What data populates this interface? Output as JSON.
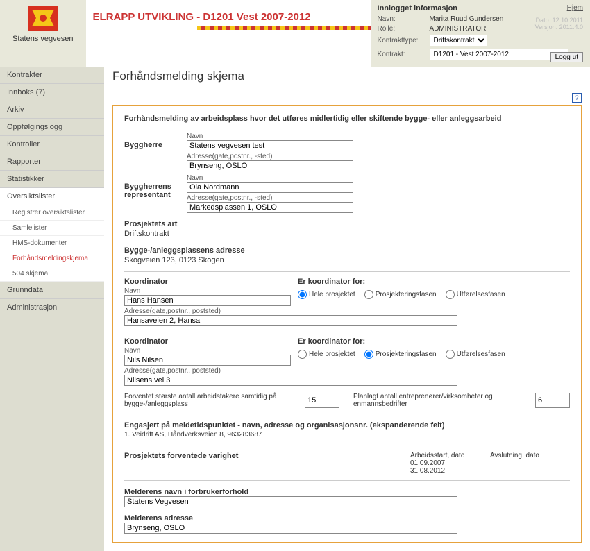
{
  "brand": "Statens vegvesen",
  "app_title": "ELRAPP UTVIKLING - D1201 Vest 2007-2012",
  "header": {
    "title": "Innlogget informasjon",
    "home": "Hjem",
    "date_label": "Dato:",
    "date": "12.10.2011",
    "version_label": "Versjon:",
    "version": "2011.4.0",
    "name_label": "Navn:",
    "name": "Marita Ruud Gundersen",
    "role_label": "Rolle:",
    "role": "ADMINISTRATOR",
    "ktype_label": "Kontrakttype:",
    "ktype": "Driftskontrakt",
    "kontrakt_label": "Kontrakt:",
    "kontrakt": "D1201 - Vest 2007-2012",
    "logout": "Logg ut"
  },
  "nav": {
    "kontrakter": "Kontrakter",
    "innboks": "Innboks (7)",
    "arkiv": "Arkiv",
    "oppfolgingslogg": "Oppfølgingslogg",
    "kontroller": "Kontroller",
    "rapporter": "Rapporter",
    "statistikker": "Statistikker",
    "oversiktslister": "Oversiktslister",
    "sub_registrer": "Registrer oversiktslister",
    "sub_samlelister": "Samlelister",
    "sub_hms": "HMS-dokumenter",
    "sub_forhand": "Forhåndsmeldingskjema",
    "sub_504": "504 skjema",
    "grunndata": "Grunndata",
    "administrasjon": "Administrasjon"
  },
  "page": {
    "title": "Forhåndsmelding skjema",
    "heading": "Forhåndsmelding av arbeidsplass hvor det utføres midlertidig eller skiftende bygge- eller anleggsarbeid"
  },
  "labels": {
    "byggherre": "Byggherre",
    "byggherrens_rep": "Byggherrens representant",
    "navn": "Navn",
    "adresse": "Adresse(gate,postnr., -sted)",
    "adresse_poststed": "Adresse(gate,postnr., poststed)",
    "prosjektets_art": "Prosjektets art",
    "byggeanlegg_adresse": "Bygge-/anleggsplassens adresse",
    "koordinator": "Koordinator",
    "er_koordinator_for": "Er koordinator for:",
    "hele": "Hele prosjektet",
    "prosjektering": "Prosjekteringsfasen",
    "utforelse": "Utførelsesfasen",
    "forventet_antall": "Forventet største antall arbeidstakere samtidig på bygge-/anleggsplass",
    "planlagt_antall": "Planlagt antall entreprenører/virksomheter og enmannsbedrifter",
    "engasjert": "Engasjert på meldetidspunktet - navn, adresse og organisasjonsnr. (ekspanderende felt)",
    "engasjert_item": "1. Veidrift AS, Håndverksveien 8, 963283687",
    "varighet": "Prosjektets forventede varighet",
    "arbeidsstart": "Arbeidsstart, dato",
    "avslutning": "Avslutning, dato",
    "melderens_navn": "Melderens navn i forbrukerforhold",
    "melderens_adresse": "Melderens adresse"
  },
  "form": {
    "byggherre_navn": "Statens vegvesen test",
    "byggherre_adresse": "Brynseng, OSLO",
    "rep_navn": "Ola Nordmann",
    "rep_adresse": "Markedsplassen 1, OSLO",
    "prosjektets_art": "Driftskontrakt",
    "bygge_adresse": "Skogveien 123, 0123 Skogen",
    "koord1_navn": "Hans Hansen",
    "koord1_adresse": "Hansaveien 2, Hansa",
    "koord2_navn": "Nils Nilsen",
    "koord2_adresse": "Nilsens vei 3",
    "forventet_antall": "15",
    "planlagt_antall": "6",
    "arbeidsstart": "01.09.2007",
    "avslutning": "31.08.2012",
    "melderens_navn": "Statens Vegvesen",
    "melderens_adresse": "Brynseng, OSLO"
  }
}
